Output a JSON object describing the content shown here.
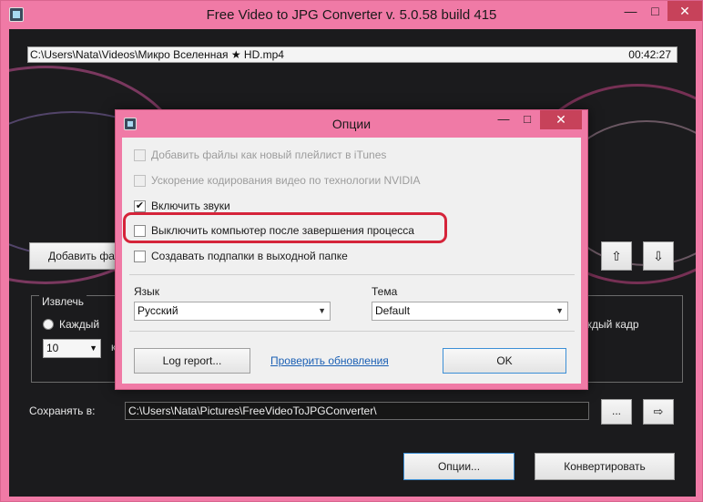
{
  "main": {
    "title": "Free Video to JPG Converter  v. 5.0.58 build 415",
    "controls": {
      "minimize": "—",
      "maximize": "□",
      "close": "✕"
    },
    "file_path": "C:\\Users\\Nata\\Videos\\Микро Вселенная ★ HD.mp4",
    "duration": "00:42:27",
    "add_button": "Добавить фа",
    "up_icon": "⇧",
    "down_icon": "⇩",
    "extract_label": "Извлечь",
    "radio_label": "Каждый",
    "n_value": "10",
    "n_suffix": "к",
    "every_frame_label": "ждый кадр",
    "save_label": "Сохранять в:",
    "save_path": "C:\\Users\\Nata\\Pictures\\FreeVideoToJPGConverter\\",
    "browse_button": "...",
    "folder_icon": "⇨",
    "options_button": "Опции...",
    "convert_button": "Конвертировать"
  },
  "dialog": {
    "title": "Опции",
    "controls": {
      "minimize": "—",
      "maximize": "□",
      "close": "✕"
    },
    "options": [
      {
        "label": "Добавить файлы как новый плейлист в iTunes",
        "checked": false,
        "disabled": true
      },
      {
        "label": "Ускорение кодирования видео по технологии NVIDIA",
        "checked": false,
        "disabled": true
      },
      {
        "label": "Включить звуки",
        "checked": true,
        "disabled": false
      },
      {
        "label": "Выключить компьютер после завершения процесса",
        "checked": false,
        "disabled": false
      },
      {
        "label": "Создавать подпапки в выходной папке",
        "checked": false,
        "disabled": false
      }
    ],
    "language_label": "Язык",
    "language_value": "Русский",
    "theme_label": "Тема",
    "theme_value": "Default",
    "log_button": "Log report...",
    "update_link": "Проверить обновления",
    "ok_button": "OK",
    "check_mark": "✔"
  },
  "colors": {
    "window_frame": "#f07aa6",
    "close_button": "#c7425a",
    "highlight": "#d5243a",
    "link": "#1a5fb4"
  }
}
